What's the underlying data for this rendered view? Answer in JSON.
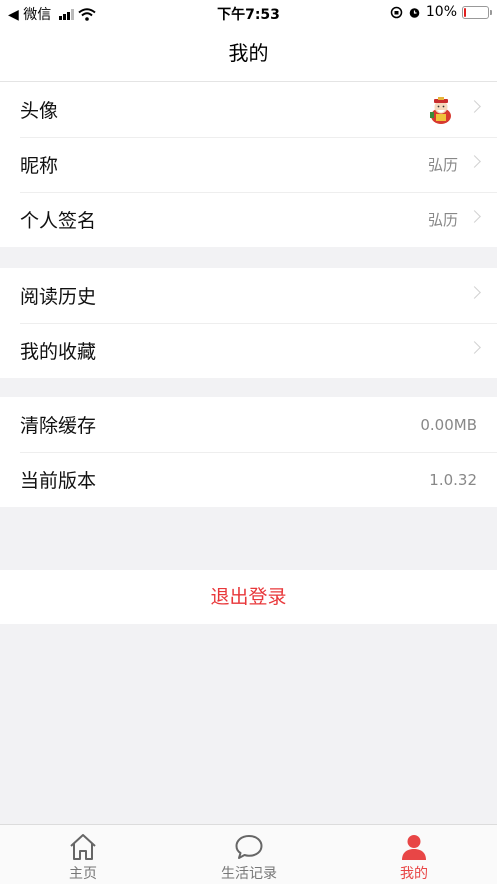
{
  "status_bar": {
    "back_label": "◀ 微信",
    "time": "下午7:53",
    "battery": "10%",
    "battery_level": 0.1
  },
  "header": {
    "title": "我的"
  },
  "profile": [
    {
      "label": "头像",
      "value": "",
      "icon": "avatar-icon"
    },
    {
      "label": "昵称",
      "value": "弘历"
    },
    {
      "label": "个人签名",
      "value": "弘历"
    }
  ],
  "library": [
    {
      "label": "阅读历史"
    },
    {
      "label": "我的收藏"
    }
  ],
  "system": [
    {
      "label": "清除缓存",
      "value": "0.00MB"
    },
    {
      "label": "当前版本",
      "value": "1.0.32"
    }
  ],
  "logout_label": "退出登录",
  "tabbar": [
    {
      "label": "主页",
      "icon": "home-icon"
    },
    {
      "label": "生活记录",
      "icon": "chat-bubble-icon"
    },
    {
      "label": "我的",
      "icon": "person-icon"
    }
  ],
  "colors": {
    "accent": "#e84646",
    "logout": "#e8373a",
    "background": "#f2f2f4"
  }
}
